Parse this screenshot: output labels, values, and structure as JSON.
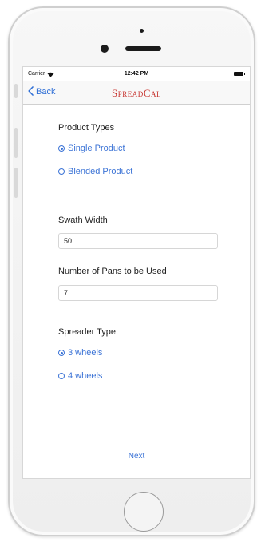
{
  "status_bar": {
    "carrier": "Carrier",
    "wifi_icon": "wifi-icon",
    "time": "12:42 PM",
    "battery_icon": "battery-icon"
  },
  "nav": {
    "back_label": "Back",
    "back_icon": "chevron-left-icon",
    "title": "SpreadCal",
    "title_color": "#c62f2a"
  },
  "form": {
    "product_types_label": "Product Types",
    "product_options": [
      {
        "label": "Single Product",
        "selected": true
      },
      {
        "label": "Blended Product",
        "selected": false
      }
    ],
    "swath_width_label": "Swath Width",
    "swath_width_value": "50",
    "pans_label": "Number of Pans to be Used",
    "pans_value": "7",
    "spreader_type_label": "Spreader Type:",
    "spreader_options": [
      {
        "label": "3 wheels",
        "selected": true
      },
      {
        "label": "4 wheels",
        "selected": false
      }
    ]
  },
  "next_label": "Next",
  "colors": {
    "accent": "#3b73d6",
    "title_red": "#c62f2a"
  }
}
